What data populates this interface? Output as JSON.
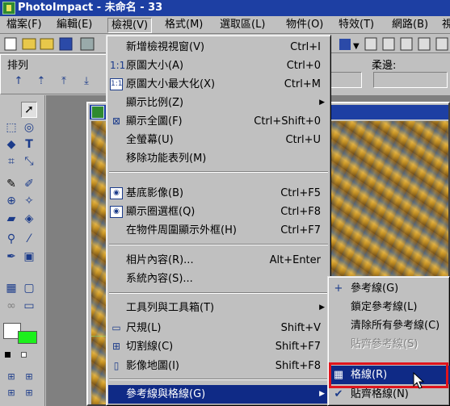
{
  "window": {
    "title": "PhotoImpact - 未命名 - 33"
  },
  "menubar": [
    {
      "label": "檔案(F)"
    },
    {
      "label": "編輯(E)"
    },
    {
      "label": "檢視(V)"
    },
    {
      "label": "格式(M)"
    },
    {
      "label": "選取區(L)"
    },
    {
      "label": "物件(O)"
    },
    {
      "label": "特效(T)"
    },
    {
      "label": "網路(B)"
    },
    {
      "label": "視"
    }
  ],
  "panel": {
    "arrange_label": "排列",
    "edge_label": "柔邊:"
  },
  "view_menu": {
    "items": [
      {
        "label": "新增檢視視窗(V)",
        "shortcut": "Ctrl+I",
        "icon": ""
      },
      {
        "label": "原圖大小(A)",
        "shortcut": "Ctrl+0",
        "icon": "1:1"
      },
      {
        "label": "原圖大小最大化(X)",
        "shortcut": "Ctrl+M",
        "icon": "1:1"
      },
      {
        "label": "顯示比例(Z)",
        "shortcut": "",
        "icon": "",
        "submenu": true
      },
      {
        "label": "顯示全圖(F)",
        "shortcut": "Ctrl+Shift+0",
        "icon": "fit"
      },
      {
        "label": "全螢幕(U)",
        "shortcut": "Ctrl+U",
        "icon": ""
      },
      {
        "label": "移除功能表列(M)",
        "shortcut": "",
        "icon": ""
      },
      {
        "label": "基底影像(B)",
        "shortcut": "Ctrl+F5",
        "icon": "eye"
      },
      {
        "label": "顯示圈選框(Q)",
        "shortcut": "Ctrl+F8",
        "icon": "eye"
      },
      {
        "label": "在物件周圍顯示外框(H)",
        "shortcut": "Ctrl+F7",
        "icon": ""
      },
      {
        "label": "相片內容(R)...",
        "shortcut": "Alt+Enter",
        "icon": ""
      },
      {
        "label": "系統內容(S)...",
        "shortcut": "",
        "icon": ""
      },
      {
        "label": "工具列與工具箱(T)",
        "shortcut": "",
        "icon": "",
        "submenu": true
      },
      {
        "label": "尺規(L)",
        "shortcut": "Shift+V",
        "icon": "ruler"
      },
      {
        "label": "切割線(C)",
        "shortcut": "Shift+F7",
        "icon": "slice"
      },
      {
        "label": "影像地圖(I)",
        "shortcut": "Shift+F8",
        "icon": "map"
      },
      {
        "label": "參考線與格線(G)",
        "shortcut": "",
        "icon": "",
        "submenu": true,
        "highlighted": true
      }
    ]
  },
  "guides_submenu": {
    "items": [
      {
        "label": "參考線(G)",
        "icon": "+",
        "disabled": false
      },
      {
        "label": "鎖定參考線(L)",
        "icon": "",
        "disabled": false
      },
      {
        "label": "清除所有參考線(C)",
        "icon": "",
        "disabled": false
      },
      {
        "label": "貼齊參考線(S)",
        "icon": "",
        "disabled": true
      },
      {
        "label": "格線(R)",
        "icon": "grid",
        "disabled": false,
        "highlighted": true
      },
      {
        "label": "貼齊格線(N)",
        "icon": "✔",
        "disabled": false
      }
    ]
  },
  "colors": {
    "highlight": "#0f2a86",
    "callout": "#e0141c",
    "title_bar": "#1d3fa3"
  }
}
